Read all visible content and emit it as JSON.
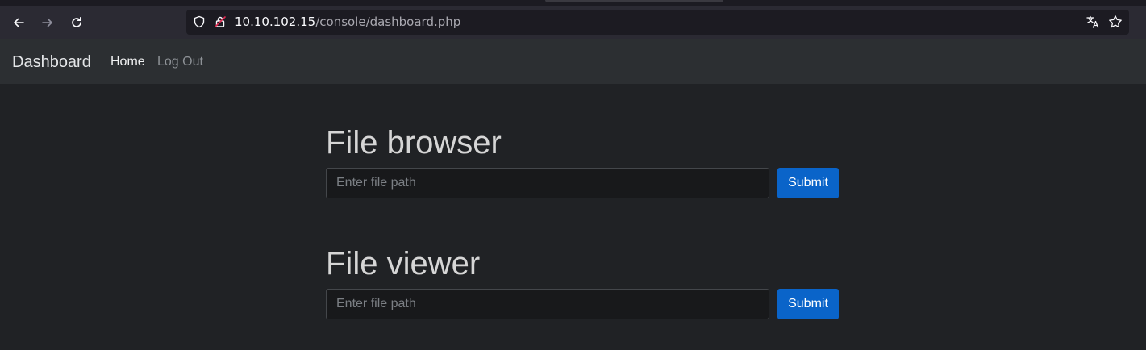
{
  "browser": {
    "url_host": "10.10.102.15",
    "url_path": "/console/dashboard.php",
    "icons": {
      "back": "back-arrow-icon",
      "forward": "forward-arrow-icon",
      "reload": "reload-icon",
      "shield": "shield-icon",
      "lock": "insecure-lock-icon",
      "translate": "translate-icon",
      "bookmark": "star-icon"
    }
  },
  "navbar": {
    "brand": "Dashboard",
    "links": [
      {
        "label": "Home",
        "active": true
      },
      {
        "label": "Log Out",
        "active": false
      }
    ]
  },
  "sections": [
    {
      "title": "File browser",
      "input_placeholder": "Enter file path",
      "button_label": "Submit"
    },
    {
      "title": "File viewer",
      "input_placeholder": "Enter file path",
      "button_label": "Submit"
    }
  ],
  "colors": {
    "page_bg": "#202225",
    "navbar_bg": "#2c2f32",
    "primary_button": "#0a64c9"
  }
}
